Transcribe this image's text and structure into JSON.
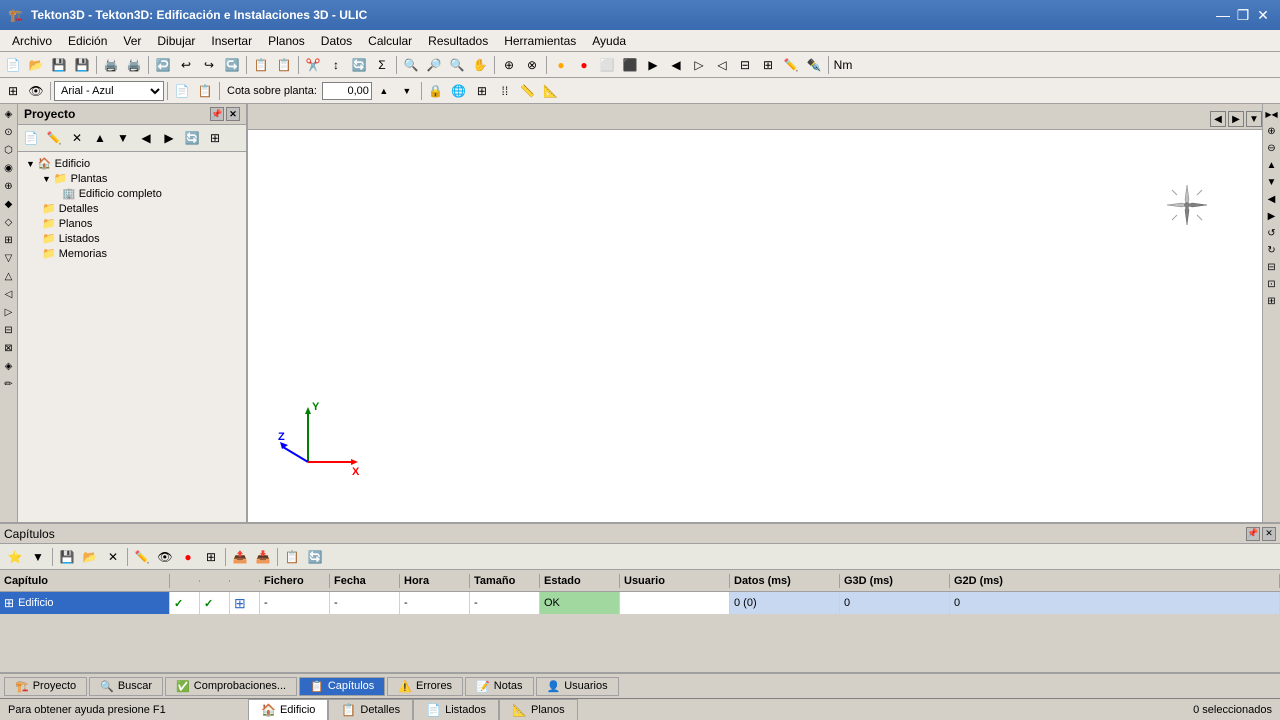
{
  "titleBar": {
    "icon": "🏗️",
    "title": "Tekton3D - Tekton3D: Edificación e Instalaciones 3D - ULIC",
    "controls": {
      "minimize": "—",
      "maximize": "❐",
      "close": "✕"
    }
  },
  "menuBar": {
    "items": [
      "Archivo",
      "Edición",
      "Ver",
      "Dibujar",
      "Insertar",
      "Planos",
      "Datos",
      "Calcular",
      "Resultados",
      "Herramientas",
      "Ayuda"
    ]
  },
  "toolbar1": {
    "fontSelect": "Arial - Azul",
    "costaLabel": "Cota sobre planta:",
    "cotaValue": "0,00"
  },
  "projectPanel": {
    "title": "Proyecto",
    "treeItems": [
      {
        "id": "edificio",
        "label": "Edificio",
        "level": 0,
        "icon": "🏠",
        "selected": false
      },
      {
        "id": "plantas",
        "label": "Plantas",
        "level": 1,
        "icon": "📁",
        "selected": false
      },
      {
        "id": "edificio-completo",
        "label": "Edificio completo",
        "level": 2,
        "icon": "🏢",
        "selected": false
      },
      {
        "id": "detalles",
        "label": "Detalles",
        "level": 1,
        "icon": "📁",
        "selected": false
      },
      {
        "id": "planos",
        "label": "Planos",
        "level": 1,
        "icon": "📁",
        "selected": false
      },
      {
        "id": "listados",
        "label": "Listados",
        "level": 1,
        "icon": "📁",
        "selected": false
      },
      {
        "id": "memorias",
        "label": "Memorias",
        "level": 1,
        "icon": "📁",
        "selected": false
      }
    ]
  },
  "viewportTabs": [
    {
      "id": "edificio",
      "label": "Edificio",
      "icon": "🏠",
      "active": true
    },
    {
      "id": "detalles",
      "label": "Detalles",
      "icon": "📋",
      "active": false
    },
    {
      "id": "listados",
      "label": "Listados",
      "icon": "📄",
      "active": false
    },
    {
      "id": "planos",
      "label": "Planos",
      "icon": "📐",
      "active": false
    }
  ],
  "chaptersPanel": {
    "title": "Capítulos",
    "tableHeaders": [
      "Capítulo",
      "",
      "",
      "",
      "Fichero",
      "Fecha",
      "Hora",
      "Tamaño",
      "Estado",
      "Usuario",
      "Datos (ms)",
      "G3D (ms)",
      "G2D (ms)"
    ],
    "rows": [
      {
        "name": "Edificio",
        "check1": "✓",
        "check2": "✓",
        "grid": "⊞",
        "fichero": "-",
        "fecha": "-",
        "hora": "-",
        "tamano": "-",
        "estado": "OK",
        "usuario": "",
        "datos": "0 (0)",
        "g3d": "0",
        "g2d": "0"
      }
    ]
  },
  "bottomTabs": [
    {
      "id": "proyecto",
      "label": "Proyecto",
      "icon": "🏗️",
      "active": false
    },
    {
      "id": "buscar",
      "label": "Buscar",
      "icon": "🔍",
      "active": false
    },
    {
      "id": "comprobaciones",
      "label": "Comprobaciones...",
      "icon": "✅",
      "active": false
    },
    {
      "id": "capitulos",
      "label": "Capítulos",
      "icon": "📋",
      "active": true
    },
    {
      "id": "errores",
      "label": "Errores",
      "icon": "⚠️",
      "active": false
    },
    {
      "id": "notas",
      "label": "Notas",
      "icon": "📝",
      "active": false
    },
    {
      "id": "usuarios",
      "label": "Usuarios",
      "icon": "👤",
      "active": false
    }
  ],
  "statusBar": {
    "leftText": "Para obtener ayuda presione F1",
    "rightText": "0 seleccionados"
  },
  "colors": {
    "tabActive": "#316ac5",
    "headerBg": "#d4d0c8",
    "toolbarBg": "#f0ede8"
  }
}
